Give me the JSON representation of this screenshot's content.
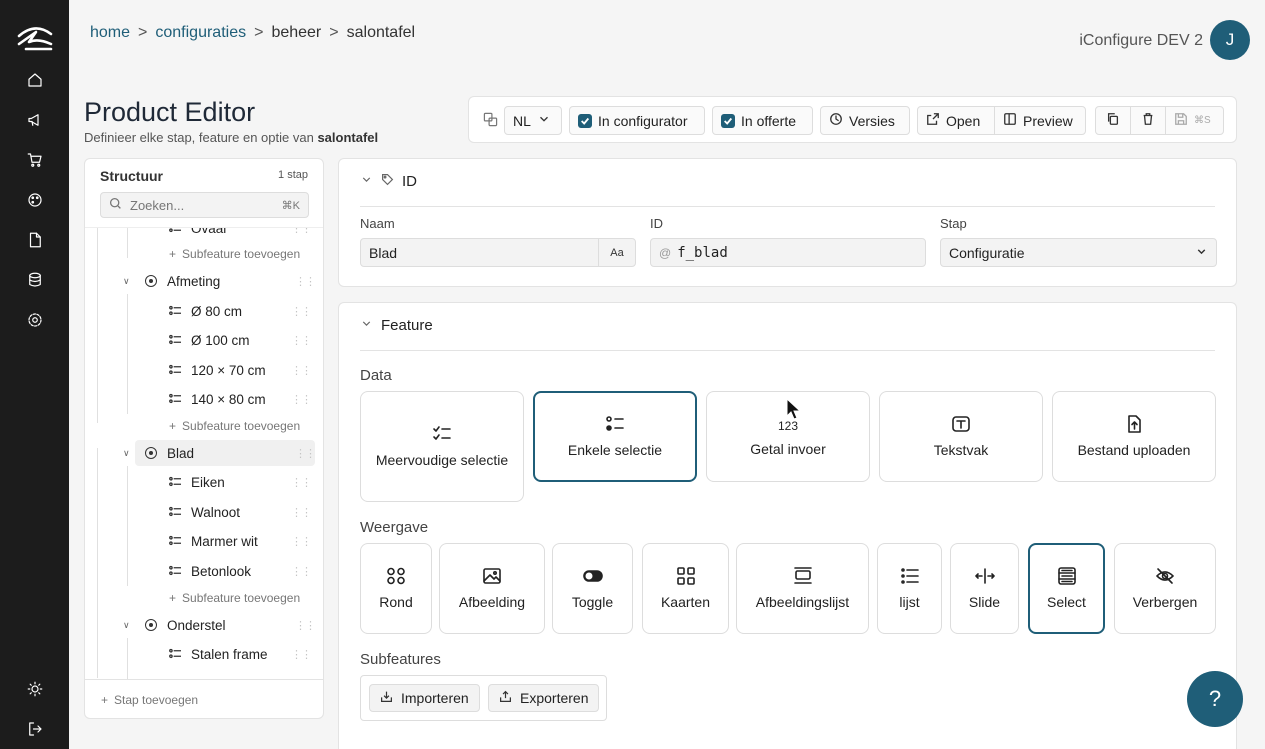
{
  "breadcrumb": [
    {
      "label": "home",
      "link": true
    },
    {
      "label": "configuraties",
      "link": true
    },
    {
      "label": "beheer",
      "link": false
    },
    {
      "label": "salontafel",
      "link": false
    }
  ],
  "breadcrumb_separator": ">",
  "header": {
    "org": "iConfigure DEV 2",
    "avatar_initial": "J"
  },
  "page": {
    "title": "Product Editor",
    "subtitle_prefix": "Definieer elke stap, feature en optie van",
    "subtitle_product": "salontafel"
  },
  "toolbar": {
    "language": "NL",
    "in_configurator": "In configurator",
    "in_offerte": "In offerte",
    "versies": "Versies",
    "open": "Open",
    "preview": "Preview",
    "save_shortcut": "⌘S"
  },
  "sidebar": {
    "title": "Structuur",
    "count": "1 stap",
    "search_placeholder": "Zoeken...",
    "search_shortcut": "⌘K",
    "tree": [
      {
        "type": "option",
        "label": "Ovaal"
      },
      {
        "type": "add",
        "label": "Subfeature toevoegen"
      },
      {
        "type": "feature",
        "label": "Afmeting"
      },
      {
        "type": "option",
        "label": "Ø 80 cm"
      },
      {
        "type": "option",
        "label": "Ø 100 cm"
      },
      {
        "type": "option",
        "label": "120 × 70 cm"
      },
      {
        "type": "option",
        "label": "140 × 80 cm"
      },
      {
        "type": "add",
        "label": "Subfeature toevoegen"
      },
      {
        "type": "feature",
        "label": "Blad",
        "selected": true
      },
      {
        "type": "option",
        "label": "Eiken"
      },
      {
        "type": "option",
        "label": "Walnoot"
      },
      {
        "type": "option",
        "label": "Marmer wit"
      },
      {
        "type": "option",
        "label": "Betonlook"
      },
      {
        "type": "add",
        "label": "Subfeature toevoegen"
      },
      {
        "type": "feature",
        "label": "Onderstel"
      },
      {
        "type": "option",
        "label": "Stalen frame"
      }
    ],
    "footer": "Stap toevoegen"
  },
  "id_card": {
    "title": "ID",
    "naam_label": "Naam",
    "naam_value": "Blad",
    "aa": "Aa",
    "id_label": "ID",
    "id_prefix": "@",
    "id_value": "f_blad",
    "stap_label": "Stap",
    "stap_value": "Configuratie"
  },
  "feature_card": {
    "title": "Feature",
    "data_label": "Data",
    "data_tiles": [
      {
        "label": "Meervoudige selectie",
        "icon": "multi-select-icon"
      },
      {
        "label": "Enkele selectie",
        "icon": "single-select-icon",
        "active": true
      },
      {
        "label": "Getal invoer",
        "icon": "number-icon",
        "glyph": "123"
      },
      {
        "label": "Tekstvak",
        "icon": "text-icon"
      },
      {
        "label": "Bestand uploaden",
        "icon": "upload-file-icon"
      }
    ],
    "weergave_label": "Weergave",
    "weergave_tiles": [
      {
        "label": "Rond",
        "icon": "circles-icon"
      },
      {
        "label": "Afbeelding",
        "icon": "image-icon"
      },
      {
        "label": "Toggle",
        "icon": "toggle-icon"
      },
      {
        "label": "Kaarten",
        "icon": "cards-icon"
      },
      {
        "label": "Afbeeldingslijst",
        "icon": "image-list-icon"
      },
      {
        "label": "lijst",
        "icon": "list-icon"
      },
      {
        "label": "Slide",
        "icon": "slide-icon"
      },
      {
        "label": "Select",
        "icon": "select-icon",
        "active": true
      },
      {
        "label": "Verbergen",
        "icon": "eye-off-icon"
      }
    ],
    "subfeatures_label": "Subfeatures",
    "import": "Importeren",
    "export": "Exporteren"
  },
  "help": "?",
  "colors": {
    "accent": "#1f5e78",
    "rail": "#1c1c1c"
  }
}
